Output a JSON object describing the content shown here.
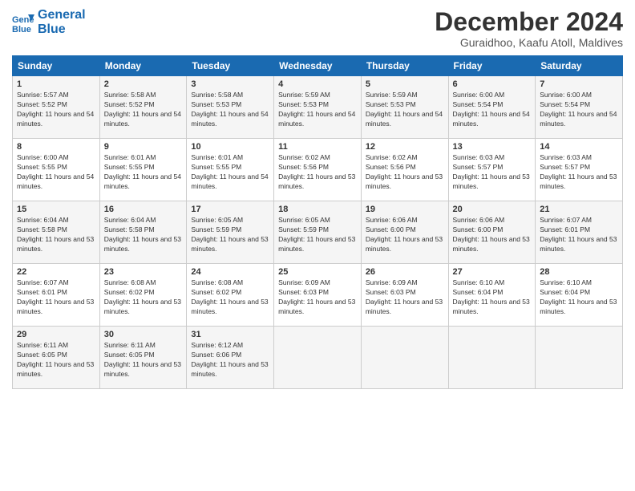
{
  "header": {
    "logo_line1": "General",
    "logo_line2": "Blue",
    "title": "December 2024",
    "location": "Guraidhoo, Kaafu Atoll, Maldives"
  },
  "weekdays": [
    "Sunday",
    "Monday",
    "Tuesday",
    "Wednesday",
    "Thursday",
    "Friday",
    "Saturday"
  ],
  "weeks": [
    [
      {
        "day": "1",
        "sunrise": "5:57 AM",
        "sunset": "5:52 PM",
        "daylight": "11 hours and 54 minutes."
      },
      {
        "day": "2",
        "sunrise": "5:58 AM",
        "sunset": "5:52 PM",
        "daylight": "11 hours and 54 minutes."
      },
      {
        "day": "3",
        "sunrise": "5:58 AM",
        "sunset": "5:53 PM",
        "daylight": "11 hours and 54 minutes."
      },
      {
        "day": "4",
        "sunrise": "5:59 AM",
        "sunset": "5:53 PM",
        "daylight": "11 hours and 54 minutes."
      },
      {
        "day": "5",
        "sunrise": "5:59 AM",
        "sunset": "5:53 PM",
        "daylight": "11 hours and 54 minutes."
      },
      {
        "day": "6",
        "sunrise": "6:00 AM",
        "sunset": "5:54 PM",
        "daylight": "11 hours and 54 minutes."
      },
      {
        "day": "7",
        "sunrise": "6:00 AM",
        "sunset": "5:54 PM",
        "daylight": "11 hours and 54 minutes."
      }
    ],
    [
      {
        "day": "8",
        "sunrise": "6:00 AM",
        "sunset": "5:55 PM",
        "daylight": "11 hours and 54 minutes."
      },
      {
        "day": "9",
        "sunrise": "6:01 AM",
        "sunset": "5:55 PM",
        "daylight": "11 hours and 54 minutes."
      },
      {
        "day": "10",
        "sunrise": "6:01 AM",
        "sunset": "5:55 PM",
        "daylight": "11 hours and 54 minutes."
      },
      {
        "day": "11",
        "sunrise": "6:02 AM",
        "sunset": "5:56 PM",
        "daylight": "11 hours and 53 minutes."
      },
      {
        "day": "12",
        "sunrise": "6:02 AM",
        "sunset": "5:56 PM",
        "daylight": "11 hours and 53 minutes."
      },
      {
        "day": "13",
        "sunrise": "6:03 AM",
        "sunset": "5:57 PM",
        "daylight": "11 hours and 53 minutes."
      },
      {
        "day": "14",
        "sunrise": "6:03 AM",
        "sunset": "5:57 PM",
        "daylight": "11 hours and 53 minutes."
      }
    ],
    [
      {
        "day": "15",
        "sunrise": "6:04 AM",
        "sunset": "5:58 PM",
        "daylight": "11 hours and 53 minutes."
      },
      {
        "day": "16",
        "sunrise": "6:04 AM",
        "sunset": "5:58 PM",
        "daylight": "11 hours and 53 minutes."
      },
      {
        "day": "17",
        "sunrise": "6:05 AM",
        "sunset": "5:59 PM",
        "daylight": "11 hours and 53 minutes."
      },
      {
        "day": "18",
        "sunrise": "6:05 AM",
        "sunset": "5:59 PM",
        "daylight": "11 hours and 53 minutes."
      },
      {
        "day": "19",
        "sunrise": "6:06 AM",
        "sunset": "6:00 PM",
        "daylight": "11 hours and 53 minutes."
      },
      {
        "day": "20",
        "sunrise": "6:06 AM",
        "sunset": "6:00 PM",
        "daylight": "11 hours and 53 minutes."
      },
      {
        "day": "21",
        "sunrise": "6:07 AM",
        "sunset": "6:01 PM",
        "daylight": "11 hours and 53 minutes."
      }
    ],
    [
      {
        "day": "22",
        "sunrise": "6:07 AM",
        "sunset": "6:01 PM",
        "daylight": "11 hours and 53 minutes."
      },
      {
        "day": "23",
        "sunrise": "6:08 AM",
        "sunset": "6:02 PM",
        "daylight": "11 hours and 53 minutes."
      },
      {
        "day": "24",
        "sunrise": "6:08 AM",
        "sunset": "6:02 PM",
        "daylight": "11 hours and 53 minutes."
      },
      {
        "day": "25",
        "sunrise": "6:09 AM",
        "sunset": "6:03 PM",
        "daylight": "11 hours and 53 minutes."
      },
      {
        "day": "26",
        "sunrise": "6:09 AM",
        "sunset": "6:03 PM",
        "daylight": "11 hours and 53 minutes."
      },
      {
        "day": "27",
        "sunrise": "6:10 AM",
        "sunset": "6:04 PM",
        "daylight": "11 hours and 53 minutes."
      },
      {
        "day": "28",
        "sunrise": "6:10 AM",
        "sunset": "6:04 PM",
        "daylight": "11 hours and 53 minutes."
      }
    ],
    [
      {
        "day": "29",
        "sunrise": "6:11 AM",
        "sunset": "6:05 PM",
        "daylight": "11 hours and 53 minutes."
      },
      {
        "day": "30",
        "sunrise": "6:11 AM",
        "sunset": "6:05 PM",
        "daylight": "11 hours and 53 minutes."
      },
      {
        "day": "31",
        "sunrise": "6:12 AM",
        "sunset": "6:06 PM",
        "daylight": "11 hours and 53 minutes."
      },
      null,
      null,
      null,
      null
    ]
  ]
}
